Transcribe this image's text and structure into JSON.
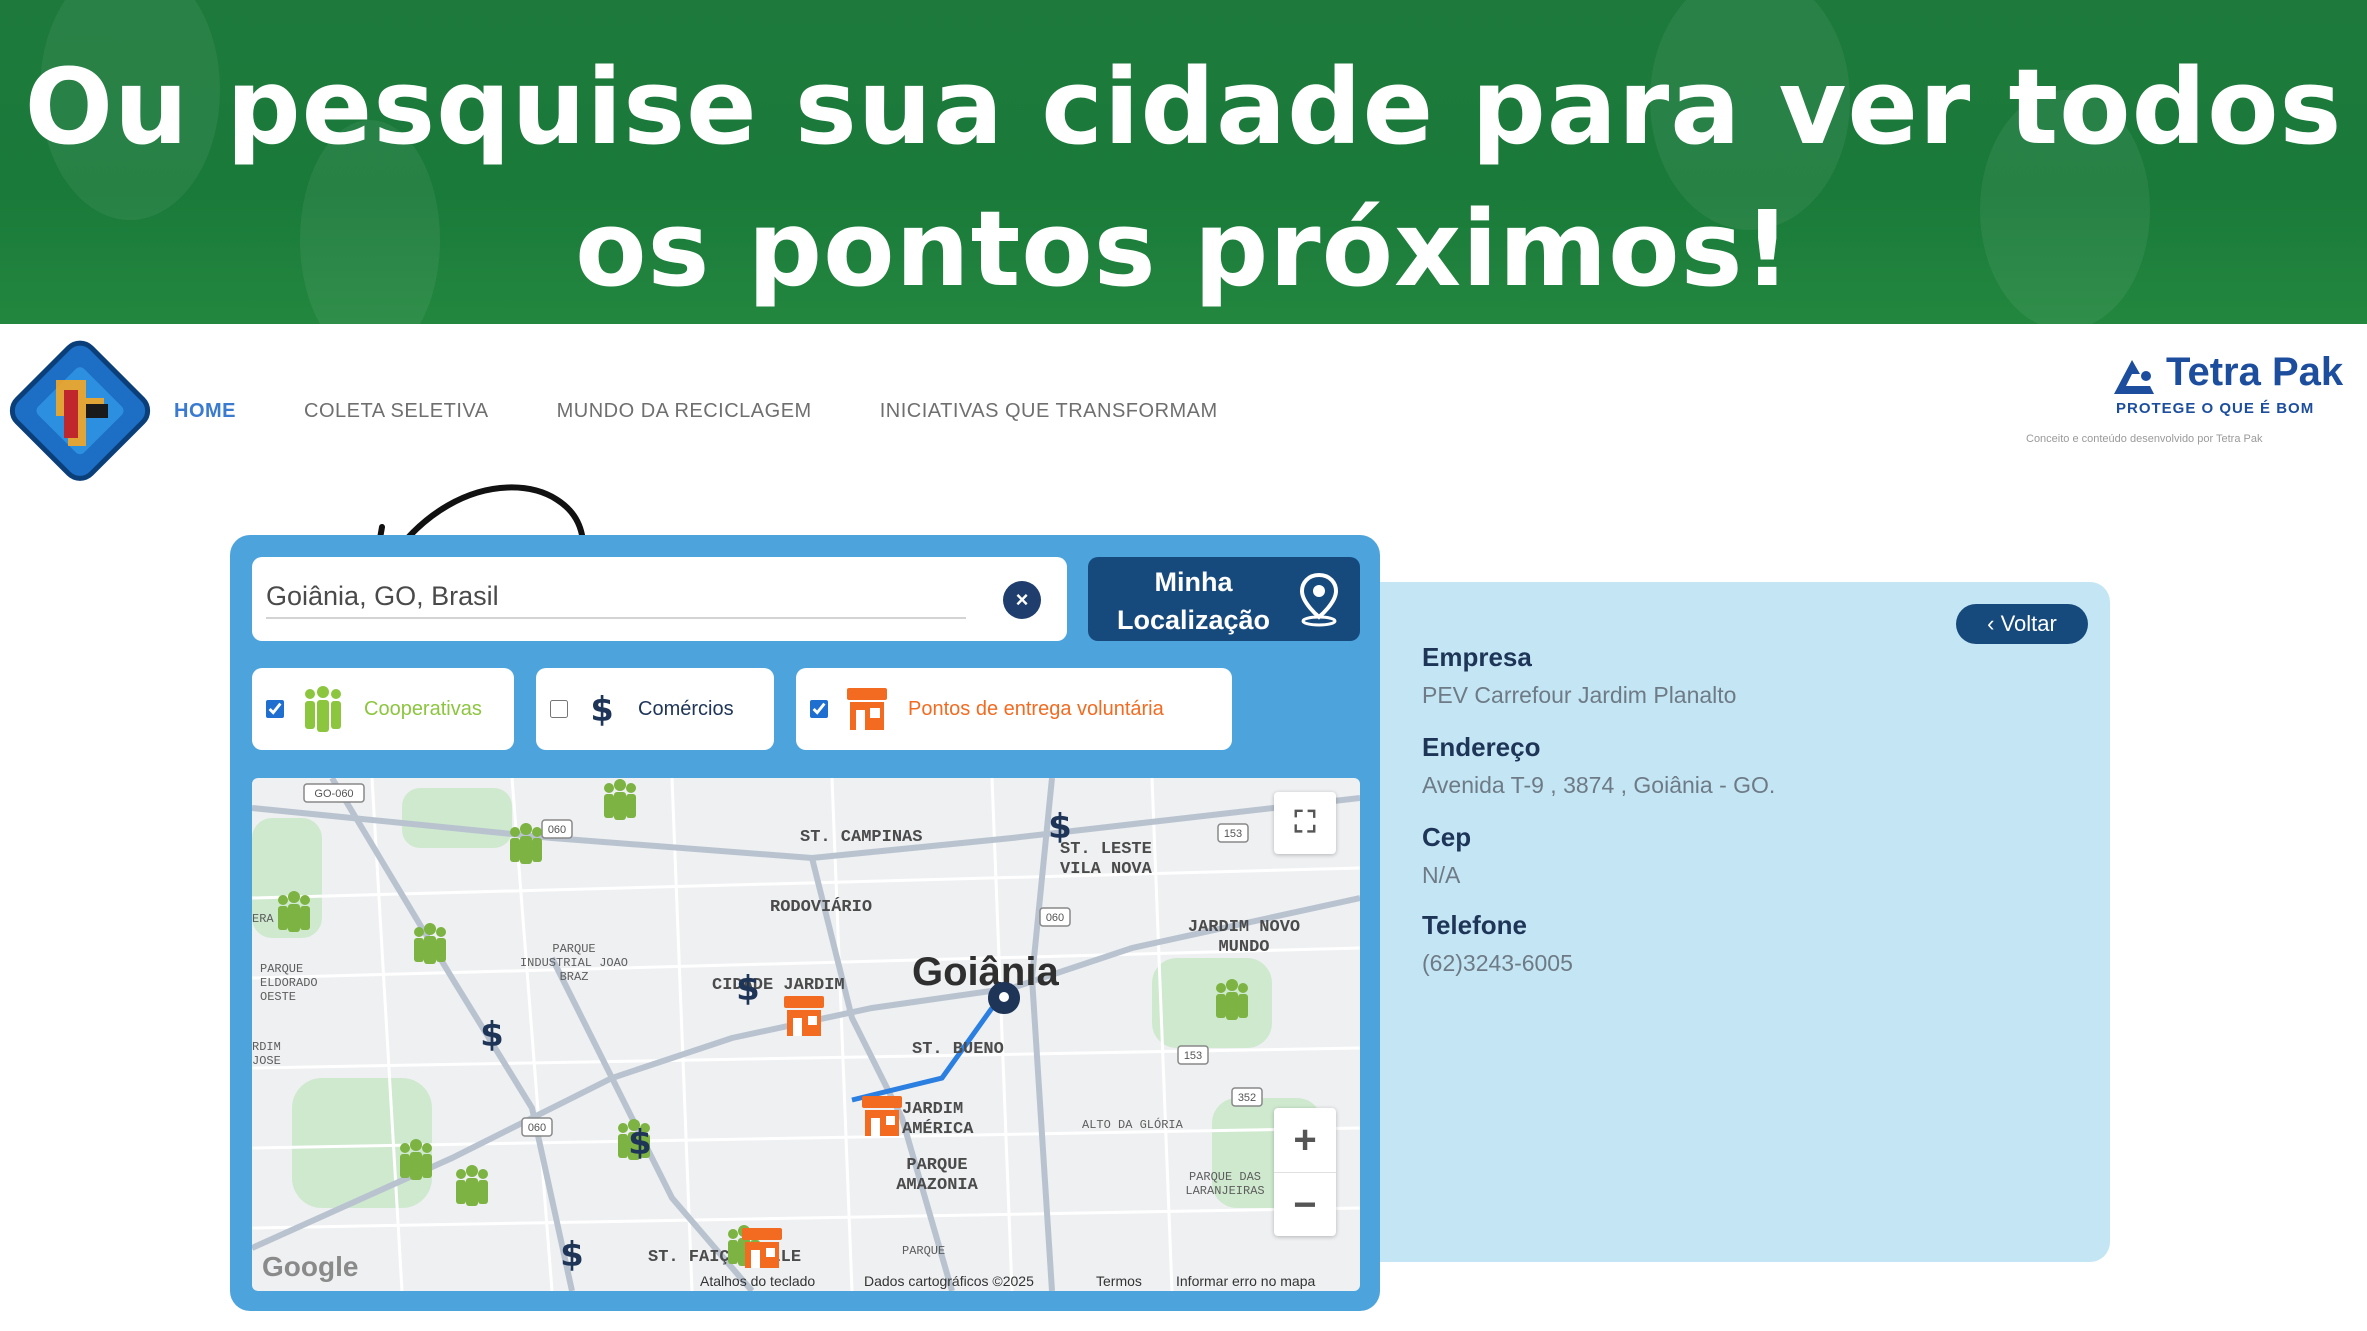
{
  "banner": {
    "title": "Ou pesquise sua cidade para ver todos os pontos próximos!"
  },
  "header": {
    "nav": [
      "HOME",
      "COLETA SELETIVA",
      "MUNDO DA RECICLAGEM",
      "INICIATIVAS QUE TRANSFORMAM"
    ],
    "active_index": 0,
    "partner": {
      "name": "Tetra Pak",
      "tagline": "PROTEGE O QUE É BOM",
      "credit": "Conceito e conteúdo desenvolvido por Tetra Pak"
    }
  },
  "search": {
    "value": "Goiânia, GO, Brasil",
    "placeholder": "",
    "clear_icon": "clear-icon"
  },
  "location_button": {
    "label_line1": "Minha",
    "label_line2": "Localização",
    "icon": "map-pin-icon"
  },
  "filters": [
    {
      "label": "Cooperativas",
      "checked": true,
      "icon": "people-icon",
      "color": "#8cc63f"
    },
    {
      "label": "Comércios",
      "checked": false,
      "icon": "dollar-icon",
      "color": "#1e3558"
    },
    {
      "label": "Pontos de entrega voluntária",
      "checked": true,
      "icon": "pev-store-icon",
      "color": "#f26b21"
    }
  ],
  "map": {
    "city": "Goiânia",
    "neighborhoods": [
      "ST. CAMPINAS",
      "ST. LESTE VILA NOVA",
      "RODOVIÁRIO",
      "JARDIM NOVO MUNDO",
      "CIDADE JARDIM",
      "ST. BUENO",
      "JARDIM AMÉRICA",
      "ALTO DA GLÓRIA",
      "PARQUE AMAZONIA",
      "PARQUE DAS LARANJEIRAS",
      "PARQUE INDUSTRIAL JOAO BRAZ",
      "PARQUE ELDORADO OESTE",
      "ST. FAIÇALVILLE",
      "PARQUE",
      "ERA FRUZ",
      "RDIM JOSE"
    ],
    "route_numbers": [
      "GO-060",
      "060",
      "153",
      "060",
      "153",
      "060",
      "352"
    ],
    "zoom_in": "+",
    "zoom_out": "−",
    "fullscreen_icon": "fullscreen-icon",
    "attribution": [
      "Atalhos do teclado",
      "Dados cartográficos ©2025",
      "Termos",
      "Informar erro no mapa"
    ],
    "provider": "Google"
  },
  "detail": {
    "back_label": "Voltar",
    "fields": [
      {
        "label": "Empresa",
        "value": "PEV Carrefour Jardim Planalto"
      },
      {
        "label": "Endereço",
        "value": "Avenida T-9 , 3874 , Goiânia - GO."
      },
      {
        "label": "Cep",
        "value": "N/A"
      },
      {
        "label": "Telefone",
        "value": "(62)3243-6005"
      }
    ]
  },
  "colors": {
    "banner_green": "#1a7a3a",
    "panel_blue": "#4da4dc",
    "navy": "#174a7c",
    "card_blue": "#c4e6f4",
    "coop_green": "#8cc63f",
    "pev_orange": "#f26b21"
  }
}
